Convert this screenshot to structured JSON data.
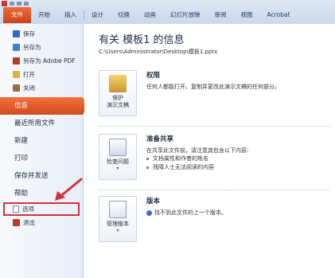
{
  "ribbon": {
    "tabs": [
      "文件",
      "开始",
      "插入",
      "设计",
      "切换",
      "动画",
      "幻灯片放映",
      "审阅",
      "视图",
      "Acrobat"
    ]
  },
  "nav": {
    "small_items": [
      {
        "label": "保存",
        "icon": "save-icon",
        "color": "#2d6bc4"
      },
      {
        "label": "另存为",
        "icon": "save-as-icon",
        "color": "#3f7fd0"
      },
      {
        "label": "另存为 Adobe PDF",
        "icon": "pdf-icon",
        "color": "#b63b2a"
      },
      {
        "label": "打开",
        "icon": "open-folder-icon",
        "color": "#e0b43a"
      },
      {
        "label": "关闭",
        "icon": "close-doc-icon",
        "color": "#9b6a3a"
      }
    ],
    "big_items": [
      "信息",
      "最近所用文件",
      "新建",
      "打印",
      "保存并发送",
      "帮助"
    ],
    "options_label": "选项",
    "exit_label": "退出"
  },
  "info": {
    "title": "有关 模板1 的信息",
    "path": "C:\\Users\\Administrator\\Desktop\\模板1.pptx",
    "permissions": {
      "button": "保护\n演示文稿",
      "heading": "权限",
      "desc": "任何人都能打开、复制并更改此演示文稿的任何部分。"
    },
    "prepare": {
      "button": "检查问题",
      "heading": "准备共享",
      "desc": "在共享此文件前，请注意其包含以下内容:",
      "bullets": [
        "文档属性和作者的姓名",
        "残障人士无法阅读的内容"
      ]
    },
    "versions": {
      "button": "管理版本",
      "heading": "版本",
      "desc": "找不到此文件的上一个版本。"
    }
  },
  "colors": {
    "accent": "#d14b1c",
    "highlight_border": "#d6303b"
  }
}
